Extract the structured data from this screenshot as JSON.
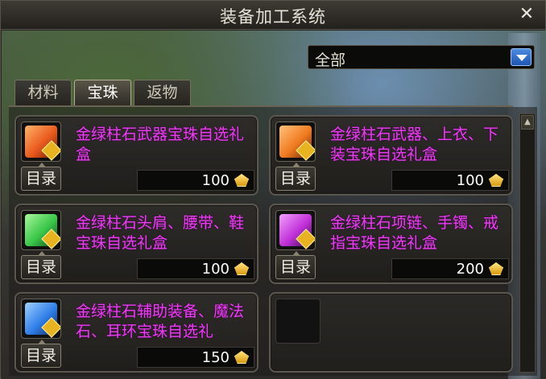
{
  "window": {
    "title": "装备加工系统"
  },
  "filter": {
    "selected": "全部"
  },
  "tabs": [
    {
      "label": "材料",
      "active": false
    },
    {
      "label": "宝珠",
      "active": true
    },
    {
      "label": "返物",
      "active": false
    }
  ],
  "items": [
    {
      "name": "金绿柱石武器宝珠自选礼盒",
      "price": "100",
      "catalog_label": "目录",
      "gem_color": "#e85a1c"
    },
    {
      "name": "金绿柱石武器、上衣、下装宝珠自选礼盒",
      "price": "100",
      "catalog_label": "目录",
      "gem_color": "#f07a20"
    },
    {
      "name": "金绿柱石头肩、腰带、鞋宝珠自选礼盒",
      "price": "100",
      "catalog_label": "目录",
      "gem_color": "#39c64a"
    },
    {
      "name": "金绿柱石项链、手镯、戒指宝珠自选礼盒",
      "price": "200",
      "catalog_label": "目录",
      "gem_color": "#c030d8"
    },
    {
      "name": "金绿柱石辅助装备、魔法石、耳环宝珠自选礼",
      "price": "150",
      "catalog_label": "目录",
      "gem_color": "#2f7ee8"
    }
  ],
  "colors": {
    "item_name": "#ea3df2",
    "accent_blue": "#1d55b3",
    "coin": "#e8b320"
  }
}
